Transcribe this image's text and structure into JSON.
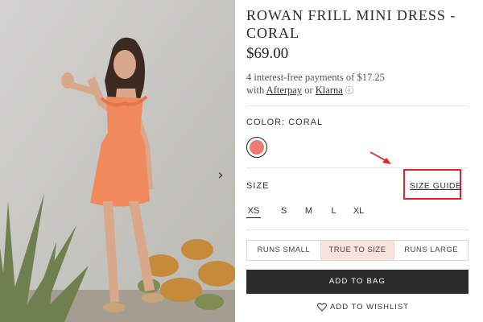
{
  "product": {
    "title": "ROWAN FRILL MINI DRESS - CORAL",
    "price": "$69.00",
    "installments_line1": "4 interest-free payments of $17.25",
    "with_text": "with ",
    "afterpay": "Afterpay",
    "or_text": " or ",
    "klarna": "Klarna",
    "info_icon": "ⓘ"
  },
  "color": {
    "label": "COLOR: CORAL",
    "swatch": "#ef7a73"
  },
  "size": {
    "label": "SIZE",
    "guide": "SIZE GUIDE",
    "options": [
      "XS",
      "S",
      "M",
      "L",
      "XL"
    ],
    "selected": "XS"
  },
  "fit": {
    "options": [
      "RUNS SMALL",
      "TRUE TO SIZE",
      "RUNS LARGE"
    ],
    "active": "TRUE TO SIZE"
  },
  "actions": {
    "add_to_bag": "ADD TO BAG",
    "wishlist": "ADD TO WISHLIST"
  },
  "gallery": {
    "next_icon": "chevron-right-icon",
    "next_glyph": "›"
  },
  "colors": {
    "highlight": "#e8202a",
    "button": "#2b2b2b",
    "fit_active": "#f9e1dc"
  }
}
